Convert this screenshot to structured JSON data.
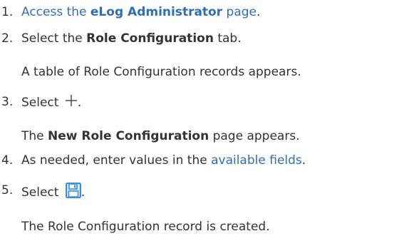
{
  "steps": [
    {
      "number": "1.",
      "link_pre": "Access the ",
      "link_bold": "eLog Administrator",
      "link_post": " page",
      "post": "."
    },
    {
      "number": "2.",
      "pre": "Select the ",
      "bold": "Role Configuration",
      "post": " tab.",
      "result": "A table of Role Configuration records appears."
    },
    {
      "number": "3.",
      "pre": "Select ",
      "icon": "plus-icon",
      "post": ".",
      "result_pre": "The ",
      "result_bold": "New Role Configuration",
      "result_post": " page appears."
    },
    {
      "number": "4.",
      "pre": "As needed, enter values in the ",
      "link": "available fields",
      "post": "."
    },
    {
      "number": "5.",
      "pre": "Select ",
      "icon": "save-icon",
      "post": ".",
      "result": "The Role Configuration record is created."
    }
  ],
  "colors": {
    "text": "#333333",
    "link": "#2e6eb8",
    "icon_blue": "#3a8fd8",
    "icon_light": "#cfe6fa"
  }
}
